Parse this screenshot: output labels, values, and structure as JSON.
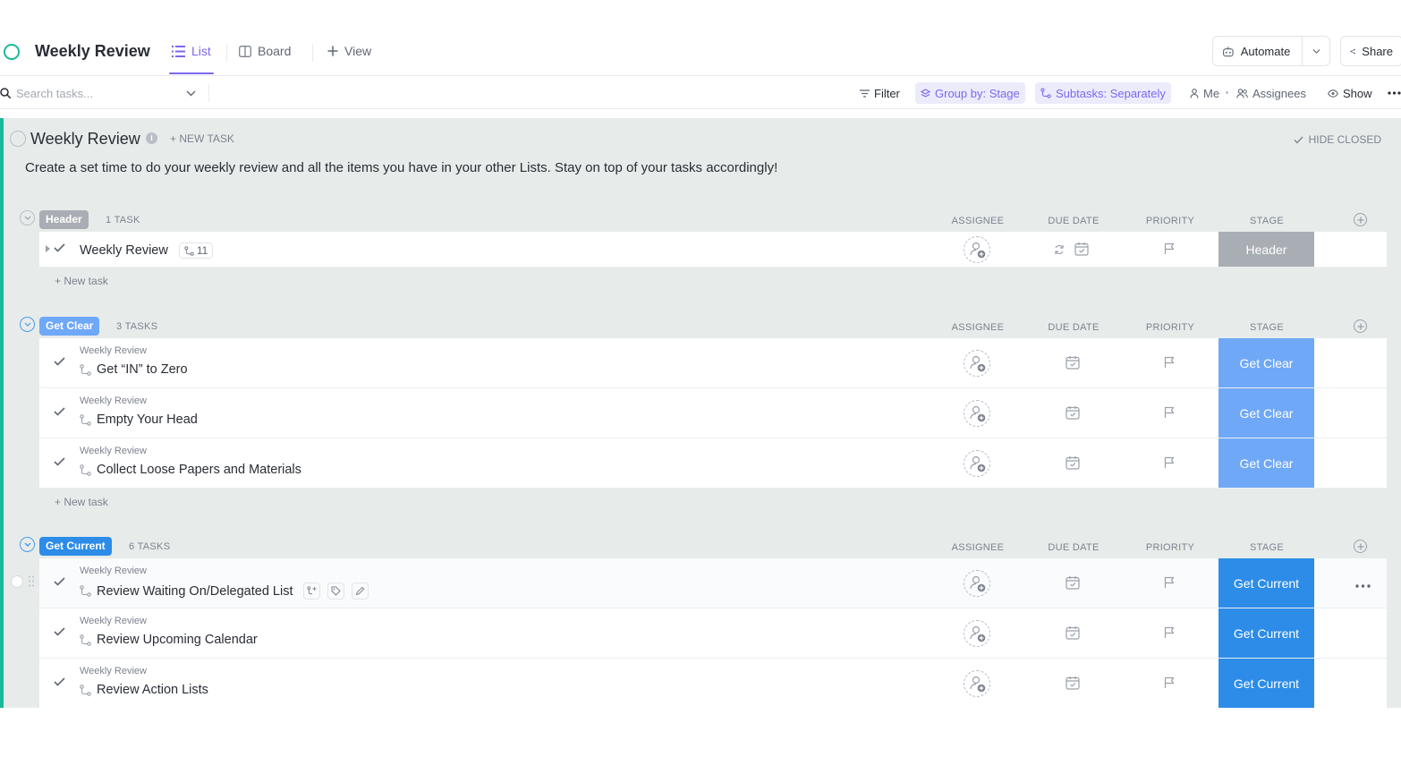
{
  "header": {
    "title": "Weekly Review",
    "tabs": [
      {
        "label": "List",
        "icon": "list-icon",
        "active": true
      },
      {
        "label": "Board",
        "icon": "board-icon",
        "active": false
      },
      {
        "label": "View",
        "icon": "plus-icon",
        "active": false
      }
    ],
    "automate_label": "Automate",
    "share_label": "Share"
  },
  "toolbar": {
    "search_placeholder": "Search tasks...",
    "filter_label": "Filter",
    "group_by_label": "Group by: Stage",
    "subtasks_label": "Subtasks: Separately",
    "me_label": "Me",
    "assignees_label": "Assignees",
    "show_label": "Show"
  },
  "list": {
    "title": "Weekly Review",
    "new_task_label": "+ NEW TASK",
    "hide_closed_label": "HIDE CLOSED",
    "description": "Create a set time to do your weekly review and all the items you have in your other Lists. Stay on top of your tasks accordingly!",
    "columns": {
      "assignee": "ASSIGNEE",
      "due_date": "DUE DATE",
      "priority": "PRIORITY",
      "stage": "STAGE"
    },
    "new_task_row_label": "+ New task"
  },
  "groups": [
    {
      "name": "Header",
      "count_label": "1 TASK",
      "color": "#a9adb4",
      "tasks": [
        {
          "parent": "",
          "name": "Weekly Review",
          "subtask_count": "11",
          "stage": "Header"
        }
      ]
    },
    {
      "name": "Get Clear",
      "count_label": "3 TASKS",
      "color": "#6fa8f7",
      "tasks": [
        {
          "parent": "Weekly Review",
          "name": "Get “IN” to Zero",
          "stage": "Get Clear"
        },
        {
          "parent": "Weekly Review",
          "name": "Empty Your Head",
          "stage": "Get Clear"
        },
        {
          "parent": "Weekly Review",
          "name": "Collect Loose Papers and Materials",
          "stage": "Get Clear"
        }
      ]
    },
    {
      "name": "Get Current",
      "count_label": "6 TASKS",
      "color": "#2c8ce8",
      "tasks": [
        {
          "parent": "Weekly Review",
          "name": "Review Waiting On/Delegated List",
          "stage": "Get Current"
        },
        {
          "parent": "Weekly Review",
          "name": "Review Upcoming Calendar",
          "stage": "Get Current"
        },
        {
          "parent": "Weekly Review",
          "name": "Review Action Lists",
          "stage": "Get Current"
        }
      ]
    }
  ]
}
